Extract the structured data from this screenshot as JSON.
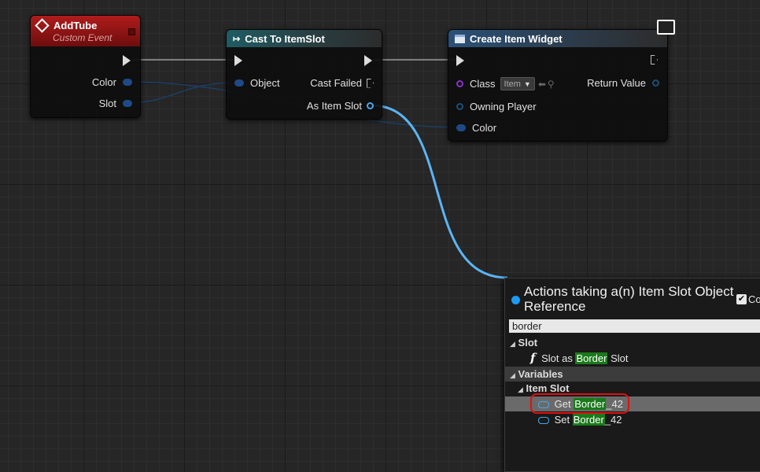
{
  "colors": {
    "event_header": "#9d1616",
    "cast_header": "#1f5c63",
    "function_header": "#2a5178",
    "wire_object": "#5cb4f5",
    "wire_exec": "#c8c8c8",
    "search_highlight": "#1a7a1a",
    "selection_box": "#e01010"
  },
  "nodes": {
    "add_tube": {
      "title": "AddTube",
      "subtitle": "Custom Event",
      "pins": {
        "color": "Color",
        "slot": "Slot"
      }
    },
    "cast": {
      "title": "Cast To ItemSlot",
      "pins": {
        "object": "Object",
        "cast_failed": "Cast Failed",
        "as_item_slot": "As Item Slot"
      }
    },
    "create_widget": {
      "title": "Create Item Widget",
      "pins": {
        "class": "Class",
        "class_value": "Item",
        "return_value": "Return Value",
        "owning_player": "Owning Player",
        "color": "Color"
      }
    }
  },
  "action_menu": {
    "title": "Actions taking a(n) Item Slot Object Reference",
    "context_label": "Co",
    "search_value": "border",
    "categories": [
      {
        "label": "Slot"
      },
      {
        "label": "Variables"
      },
      {
        "label": "Item Slot"
      }
    ],
    "items": [
      {
        "prefix": "Slot as ",
        "match": "Border",
        "suffix": " Slot"
      },
      {
        "prefix": "Get ",
        "match": "Border",
        "suffix": "_42"
      },
      {
        "prefix": "Set ",
        "match": "Border",
        "suffix": "_42"
      }
    ]
  }
}
